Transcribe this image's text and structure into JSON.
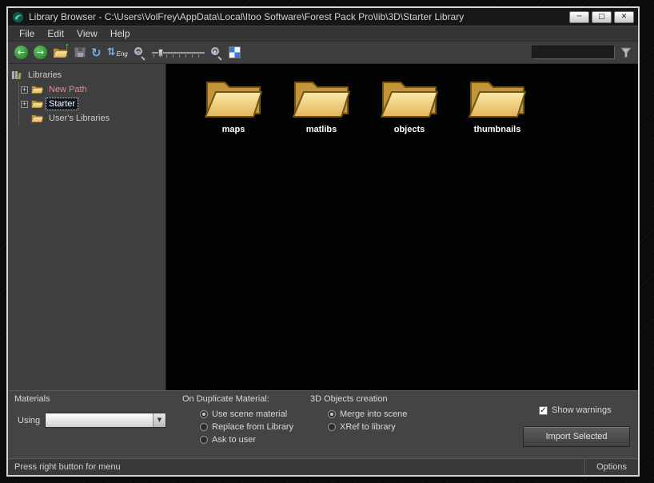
{
  "window": {
    "title": "Library Browser - C:\\Users\\VolFrey\\AppData\\Local\\Itoo Software\\Forest Pack Pro\\lib\\3D\\Starter Library",
    "controls": {
      "minimize": "─",
      "maximize": "□",
      "close": "✕"
    }
  },
  "menu": {
    "items": [
      {
        "label": "File"
      },
      {
        "label": "Edit"
      },
      {
        "label": "View"
      },
      {
        "label": "Help"
      }
    ]
  },
  "toolbar": {
    "sort_label": "Eng",
    "search_value": "",
    "icons": {
      "back": "←",
      "forward": "→",
      "up": "↑",
      "refresh": "↻",
      "sort": "⇅",
      "zoom_out": "−",
      "zoom_in": "+",
      "dropdown": "▼"
    }
  },
  "sidebar": {
    "root_label": "Libraries",
    "expander_glyph": "+",
    "items": [
      {
        "label": "New Path",
        "color": "#e09090"
      },
      {
        "label": "Starter",
        "selected": true
      },
      {
        "label": "User's Libraries"
      }
    ]
  },
  "content": {
    "folders": [
      {
        "label": "maps"
      },
      {
        "label": "matlibs"
      },
      {
        "label": "objects"
      },
      {
        "label": "thumbnails"
      }
    ]
  },
  "materials_panel": {
    "title": "Materials",
    "using_label": "Using",
    "using_value": "",
    "duplicate_title": "On Duplicate Material:",
    "duplicate_options": [
      "Use scene material",
      "Replace from Library",
      "Ask to user"
    ],
    "duplicate_selected": 0,
    "objects_title": "3D Objects creation",
    "objects_options": [
      "Merge into scene",
      "XRef to library"
    ],
    "objects_selected": 0,
    "show_warnings": {
      "label": "Show warnings",
      "checked": true,
      "glyph": "✓"
    },
    "import_button": "Import Selected"
  },
  "statusbar": {
    "left_text": "Press right button for menu",
    "right_text": "Options"
  },
  "colors": {
    "folder_yellow": "#e8c36a",
    "nav_green": "#2f9b3f",
    "selection_bg": "#0d1420",
    "new_path_text": "#e09090",
    "content_bg": "#030303"
  }
}
